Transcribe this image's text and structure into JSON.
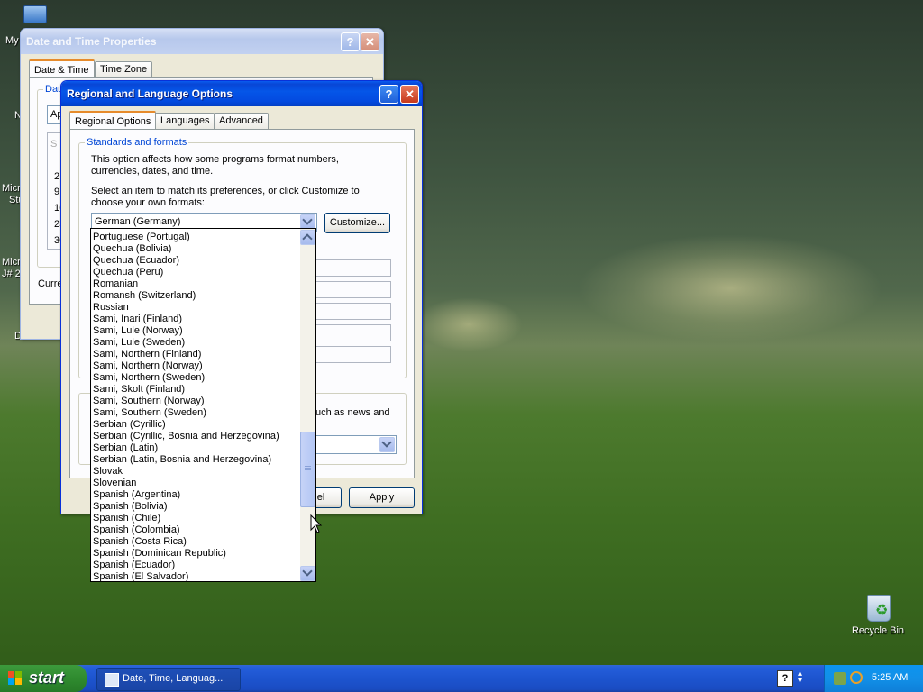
{
  "desktop": {
    "my_computer_label": "My",
    "recycle_bin_label": "Recycle Bin",
    "fragments": [
      "N",
      "Micro",
      "Stu",
      "Micro",
      "J# 2",
      "D"
    ]
  },
  "date_time_window": {
    "title": "Date and Time Properties",
    "tabs": [
      "Date & Time",
      "Time Zone"
    ],
    "group_label": "Dat",
    "combo_value": "Ap",
    "list_fragments": [
      "S",
      "2",
      "9",
      "16",
      "23",
      "30"
    ],
    "current_label": "Curre"
  },
  "regional_window": {
    "title": "Regional and Language Options",
    "tabs": [
      "Regional Options",
      "Languages",
      "Advanced"
    ],
    "standards_group": "Standards and formats",
    "desc1": "This option affects how some programs format numbers, currencies, dates, and time.",
    "desc2": "Select an item to match its preferences, or click Customize to choose your own formats:",
    "selected_locale": "German (Germany)",
    "customize_button": "Customize...",
    "location_text_fragment": "uch as news and",
    "cancel_fragment": "el",
    "apply_button": "Apply"
  },
  "dropdown": {
    "items": [
      "Portuguese (Portugal)",
      "Quechua (Bolivia)",
      "Quechua (Ecuador)",
      "Quechua (Peru)",
      "Romanian",
      "Romansh (Switzerland)",
      "Russian",
      "Sami, Inari (Finland)",
      "Sami, Lule (Norway)",
      "Sami, Lule (Sweden)",
      "Sami, Northern (Finland)",
      "Sami, Northern (Norway)",
      "Sami, Northern (Sweden)",
      "Sami, Skolt (Finland)",
      "Sami, Southern (Norway)",
      "Sami, Southern (Sweden)",
      "Serbian (Cyrillic)",
      "Serbian (Cyrillic, Bosnia and Herzegovina)",
      "Serbian (Latin)",
      "Serbian (Latin, Bosnia and Herzegovina)",
      "Slovak",
      "Slovenian",
      "Spanish (Argentina)",
      "Spanish (Bolivia)",
      "Spanish (Chile)",
      "Spanish (Colombia)",
      "Spanish (Costa Rica)",
      "Spanish (Dominican Republic)",
      "Spanish (Ecuador)",
      "Spanish (El Salvador)"
    ]
  },
  "taskbar": {
    "start_label": "start",
    "task_label": "Date, Time, Languag...",
    "help_glyph": "?",
    "clock": "5:25 AM"
  }
}
